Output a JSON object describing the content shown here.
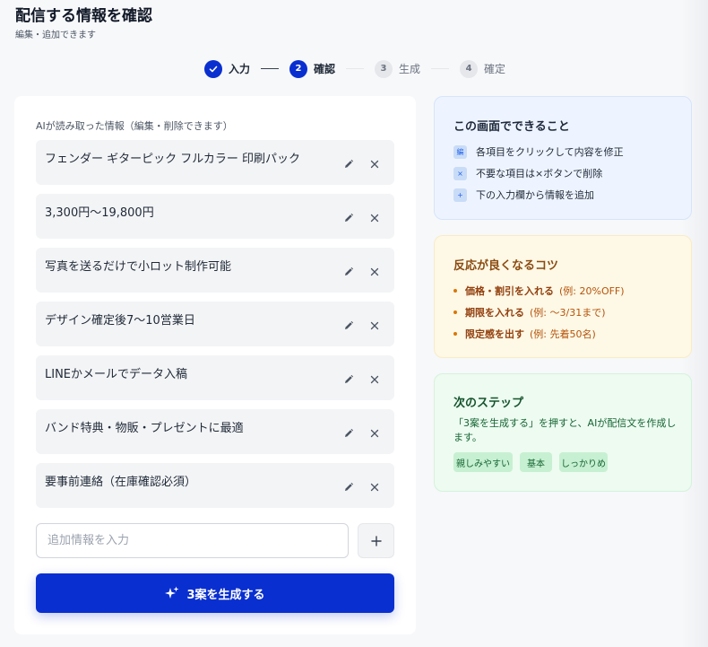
{
  "header": {
    "title": "配信する情報を確認",
    "subtitle": "編集・追加できます"
  },
  "stepper": {
    "steps": [
      {
        "number": "",
        "label": "入力",
        "state": "done"
      },
      {
        "number": "2",
        "label": "確認",
        "state": "active"
      },
      {
        "number": "3",
        "label": "生成",
        "state": "todo"
      },
      {
        "number": "4",
        "label": "確定",
        "state": "todo"
      }
    ]
  },
  "main": {
    "section_label": "AIが読み取った情報（編集・削除できます）",
    "items": [
      {
        "text": "フェンダー ギターピック フルカラー 印刷パック"
      },
      {
        "text": "3,300円〜19,800円"
      },
      {
        "text": "写真を送るだけで小ロット制作可能"
      },
      {
        "text": "デザイン確定後7〜10営業日"
      },
      {
        "text": "LINEかメールでデータ入稿"
      },
      {
        "text": "バンド特典・物販・プレゼントに最適"
      },
      {
        "text": "要事前連絡（在庫確認必須）"
      }
    ],
    "add_input": {
      "value": "",
      "placeholder": "追加情報を入力"
    },
    "generate_button": {
      "label": "3案を生成する"
    }
  },
  "panels": {
    "howto": {
      "title": "この画面でできること",
      "rows": [
        {
          "icon": "edit-icon",
          "glyph": "編",
          "text": "各項目をクリックして内容を修正"
        },
        {
          "icon": "delete-icon",
          "glyph": "×",
          "text": "不要な項目は×ボタンで削除"
        },
        {
          "icon": "add-icon",
          "glyph": "+",
          "text": "下の入力欄から情報を追加"
        }
      ]
    },
    "tips": {
      "title": "反応が良くなるコツ",
      "rows": [
        {
          "strong": "価格・割引を入れる",
          "example": "(例: 20%OFF)"
        },
        {
          "strong": "期限を入れる",
          "example": "(例: 〜3/31まで)"
        },
        {
          "strong": "限定感を出す",
          "example": "(例: 先着50名)"
        }
      ]
    },
    "next": {
      "title": "次のステップ",
      "description": "「3案を生成する」を押すと、AIが配信文を作成します。",
      "tones": [
        "親しみやすい",
        "基本",
        "しっかりめ"
      ]
    }
  },
  "colors": {
    "primary": "#0a2fd0",
    "howto_bg": "#eef4ff",
    "tips_bg": "#fef8e6",
    "next_bg": "#edfbf0"
  }
}
